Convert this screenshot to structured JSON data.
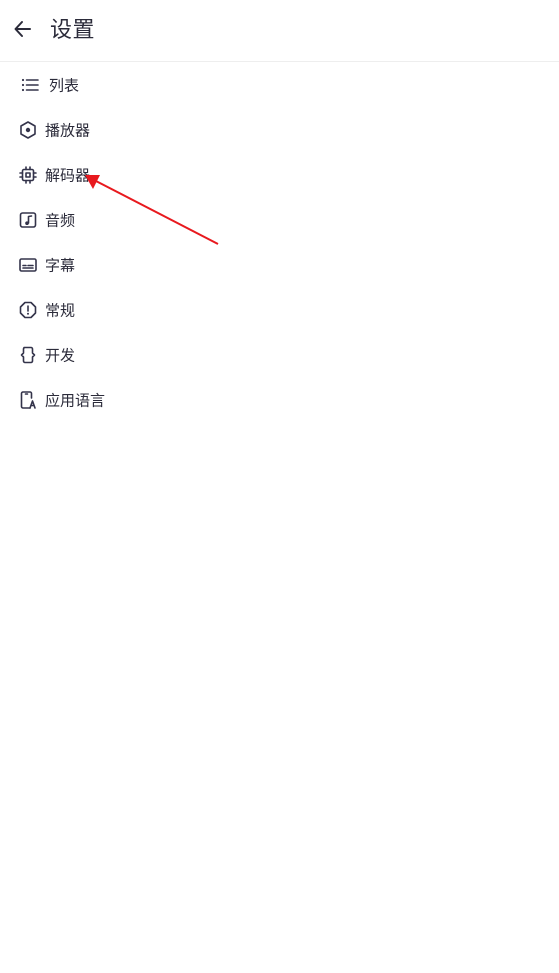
{
  "appbar": {
    "title": "设置",
    "back_icon": "arrow-left-icon"
  },
  "menu": [
    {
      "label": "列表",
      "icon": "list-icon"
    },
    {
      "label": "播放器",
      "icon": "hexagon-dot-icon"
    },
    {
      "label": "解码器",
      "icon": "chip-icon"
    },
    {
      "label": "音频",
      "icon": "music-note-icon"
    },
    {
      "label": "字幕",
      "icon": "subtitles-icon"
    },
    {
      "label": "常规",
      "icon": "alert-octagon-icon"
    },
    {
      "label": "开发",
      "icon": "code-braces-icon"
    },
    {
      "label": "应用语言",
      "icon": "phone-language-icon"
    }
  ],
  "colors": {
    "text": "#2b2b3a",
    "annotation_arrow": "#e8191e"
  }
}
